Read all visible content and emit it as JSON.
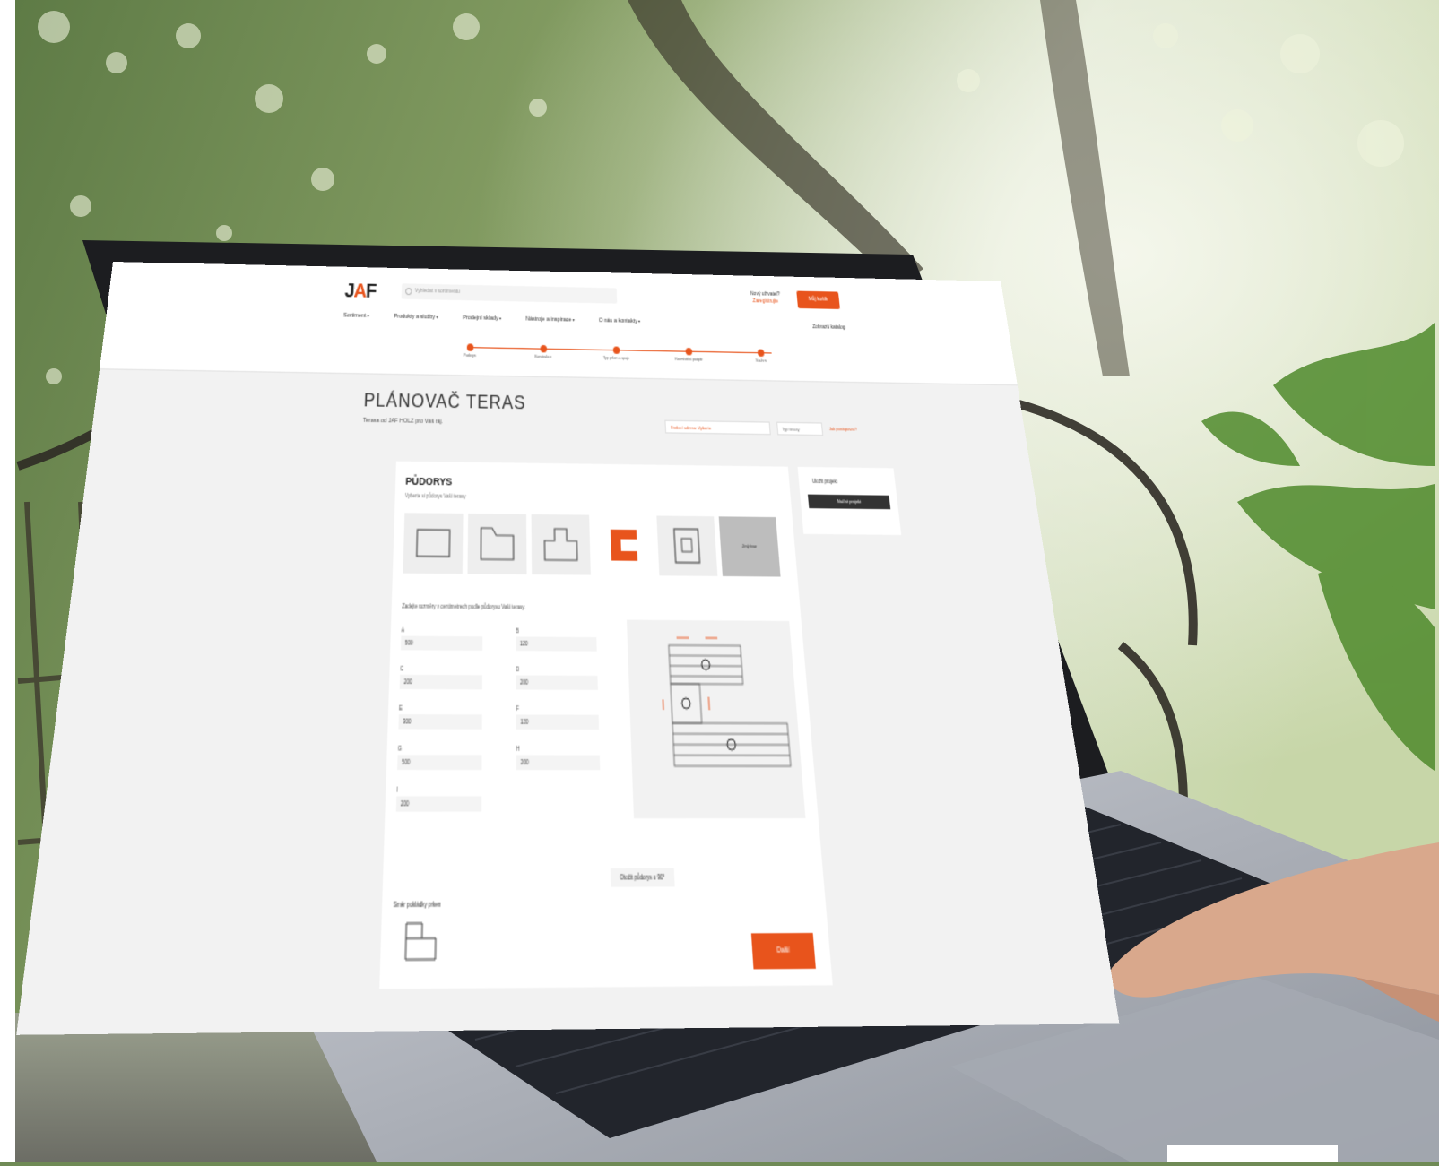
{
  "header": {
    "logo": "JAF",
    "search_placeholder": "Vyhledat v sortimentu",
    "login_label": "Nový uživatel?",
    "register_label": "Zaregistrujte",
    "cart_label": "Můj košík",
    "brochure_label": "Zobrazit katalog"
  },
  "nav": [
    "Sortiment",
    "Produkty a služby",
    "Prodejní sklady",
    "Nástroje a inspirace",
    "O nás a kontakty"
  ],
  "steps": [
    "Půdorys",
    "Konstrukce",
    "Typ prken a spoje",
    "Rozmístění podpěr",
    "Souhrn"
  ],
  "page": {
    "title": "PLÁNOVAČ TERAS",
    "subtitle": "Terasa od JAF HOLZ pro Váš ráj.",
    "select_label": "Dodací adresa: Vyberte",
    "select2_label": "Typ terasy",
    "help_link": "Jak postupovat?"
  },
  "panel": {
    "title": "PŮDORYS",
    "subtitle": "Vyberte si půdorys Vaší terasy",
    "other_shape_label": "Jiný tvar",
    "hint": "Zadejte rozměry v centimetrech podle půdorysu Vaší terasy.",
    "dimensions": [
      {
        "label": "A",
        "value": "500"
      },
      {
        "label": "B",
        "value": "120"
      },
      {
        "label": "C",
        "value": "200"
      },
      {
        "label": "D",
        "value": "200"
      },
      {
        "label": "E",
        "value": "300"
      },
      {
        "label": "F",
        "value": "120"
      },
      {
        "label": "G",
        "value": "500"
      },
      {
        "label": "H",
        "value": "200"
      },
      {
        "label": "I",
        "value": "200"
      }
    ],
    "rotate_label": "Otočit půdorys o 90°",
    "orientation_label": "Směr pokládky prken",
    "next_label": "Další"
  },
  "card": {
    "save_label": "Uložit projekt",
    "load_label": "Načíst projekt"
  },
  "colors": {
    "accent": "#e8541c",
    "screen_bg": "#f2f2f2",
    "panel_bg": "#ffffff",
    "foliage": "#6f8a55"
  }
}
